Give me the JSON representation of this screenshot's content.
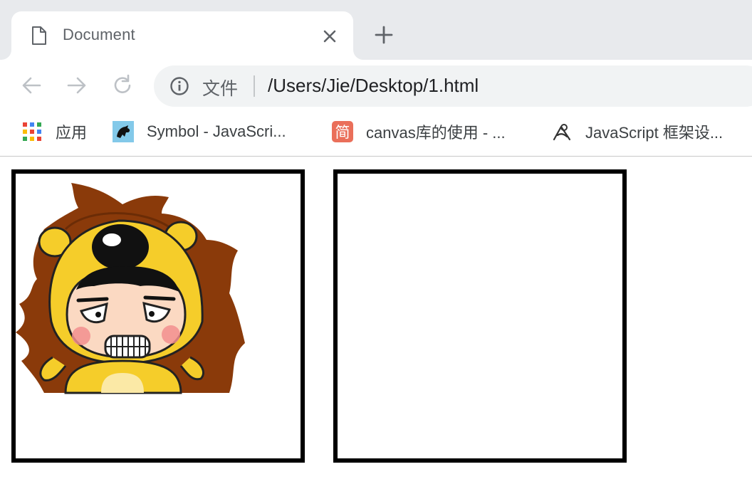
{
  "tab": {
    "title": "Document"
  },
  "toolbar": {
    "scheme_label": "文件",
    "url": "/Users/Jie/Desktop/1.html"
  },
  "bookmarks": [
    {
      "label": "应用",
      "icon": "apps-grid-icon"
    },
    {
      "label": "Symbol - JavaScri...",
      "icon": "mdn-dino-icon"
    },
    {
      "label": "canvas库的使用 - ...",
      "icon": "jianshu-icon"
    },
    {
      "label": "JavaScript 框架设...",
      "icon": "framework-logo-icon"
    }
  ],
  "page": {
    "left_canvas_image": "cartoon-lion-boy-image",
    "right_canvas": "empty"
  },
  "colors": {
    "tabstrip_bg": "#e8eaed",
    "omnibox_bg": "#f1f3f4",
    "canvas_border": "#000000"
  }
}
